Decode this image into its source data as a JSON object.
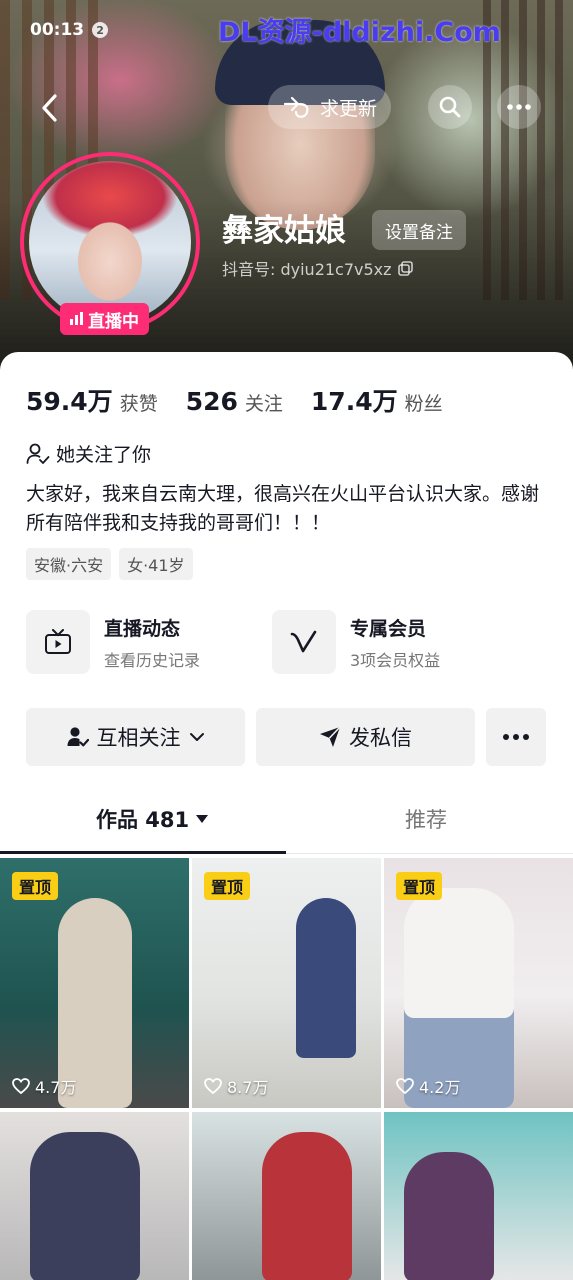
{
  "status": {
    "time": "00:13",
    "notif_count": "2"
  },
  "watermark": "DL资源-dldizhi.Com",
  "nav": {
    "update_label": "求更新"
  },
  "profile": {
    "name": "彝家姑娘",
    "remark_label": "设置备注",
    "douyin_id": "抖音号: dyiu21c7v5xz",
    "live_label": "直播中"
  },
  "stats": [
    {
      "num": "59.4万",
      "label": "获赞"
    },
    {
      "num": "526",
      "label": "关注"
    },
    {
      "num": "17.4万",
      "label": "粉丝"
    }
  ],
  "follows_you": "她关注了你",
  "bio": "大家好，我来自云南大理，很高兴在火山平台认识大家。感谢所有陪伴我和支持我的哥哥们！！！",
  "tags": [
    "安徽·六安",
    "女·41岁"
  ],
  "features": {
    "live": {
      "title": "直播动态",
      "sub": "查看历史记录"
    },
    "member": {
      "title": "专属会员",
      "sub": "3项会员权益"
    }
  },
  "actions": {
    "follow": "互相关注",
    "message": "发私信"
  },
  "tabs": {
    "works": "作品 481",
    "recommend": "推荐"
  },
  "pin_label": "置顶",
  "videos": [
    {
      "likes": "4.7万",
      "pinned": true
    },
    {
      "likes": "8.7万",
      "pinned": true
    },
    {
      "likes": "4.2万",
      "pinned": true
    },
    {
      "likes": "",
      "pinned": false
    },
    {
      "likes": "",
      "pinned": false
    },
    {
      "likes": "",
      "pinned": false
    }
  ],
  "colors": {
    "accent": "#fe2c75",
    "pin": "#face15",
    "watermark": "#4a3cf0"
  }
}
